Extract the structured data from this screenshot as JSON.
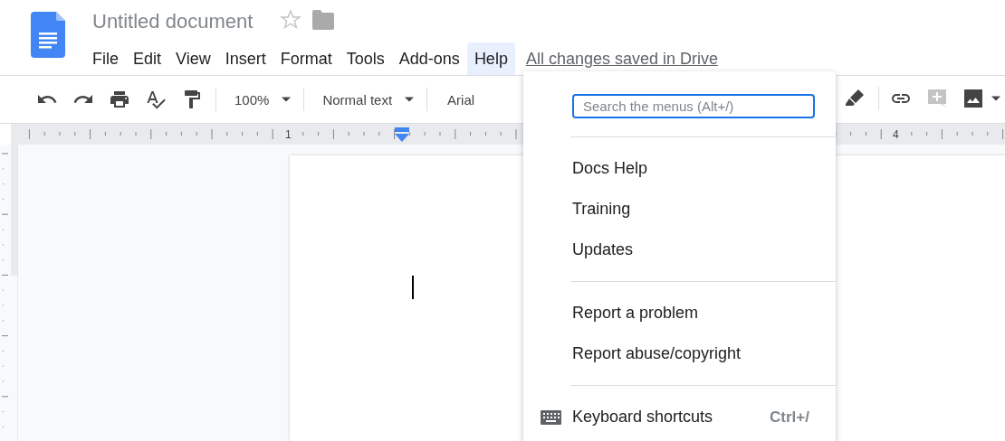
{
  "document": {
    "title": "Untitled document",
    "starred": false
  },
  "menubar": [
    {
      "label": "File",
      "selected": false
    },
    {
      "label": "Edit",
      "selected": false
    },
    {
      "label": "View",
      "selected": false
    },
    {
      "label": "Insert",
      "selected": false
    },
    {
      "label": "Format",
      "selected": false
    },
    {
      "label": "Tools",
      "selected": false
    },
    {
      "label": "Add-ons",
      "selected": false
    },
    {
      "label": "Help",
      "selected": true
    }
  ],
  "save_status": "All changes saved in Drive",
  "toolbar": {
    "zoom": "100%",
    "style": "Normal text",
    "font": "Arial"
  },
  "ruler": {
    "labels": [
      "1",
      "4"
    ]
  },
  "help_menu": {
    "search": {
      "placeholder": "Search the menus (Alt+/)"
    },
    "sections": [
      [
        {
          "label": "Docs Help"
        },
        {
          "label": "Training"
        },
        {
          "label": "Updates"
        }
      ],
      [
        {
          "label": "Report a problem"
        },
        {
          "label": "Report abuse/copyright"
        }
      ],
      [
        {
          "label": "Keyboard shortcuts",
          "kind": "keyboard",
          "shortcut": "Ctrl+/"
        }
      ]
    ]
  }
}
